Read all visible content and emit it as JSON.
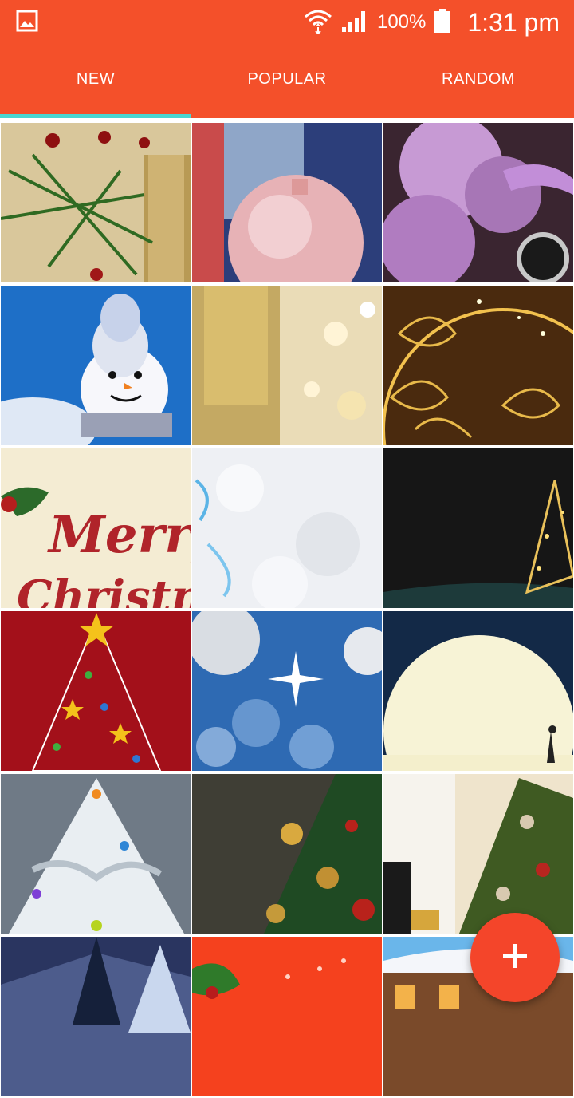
{
  "status": {
    "battery": "100%",
    "time": "1:31 pm",
    "icons": [
      "gallery-icon",
      "wifi-icon",
      "signal-icon",
      "battery-icon"
    ]
  },
  "tabs": [
    {
      "label": "NEW",
      "active": true
    },
    {
      "label": "POPULAR",
      "active": false
    },
    {
      "label": "RANDOM",
      "active": false
    }
  ],
  "tiles": {
    "merry_card": {
      "line1": "Merry",
      "line2": "Christmas"
    }
  },
  "fab": {
    "icon": "plus-icon"
  },
  "colors": {
    "primary": "#f4502a",
    "tab_indicator": "#48d6d1",
    "fab": "#f4452a"
  }
}
